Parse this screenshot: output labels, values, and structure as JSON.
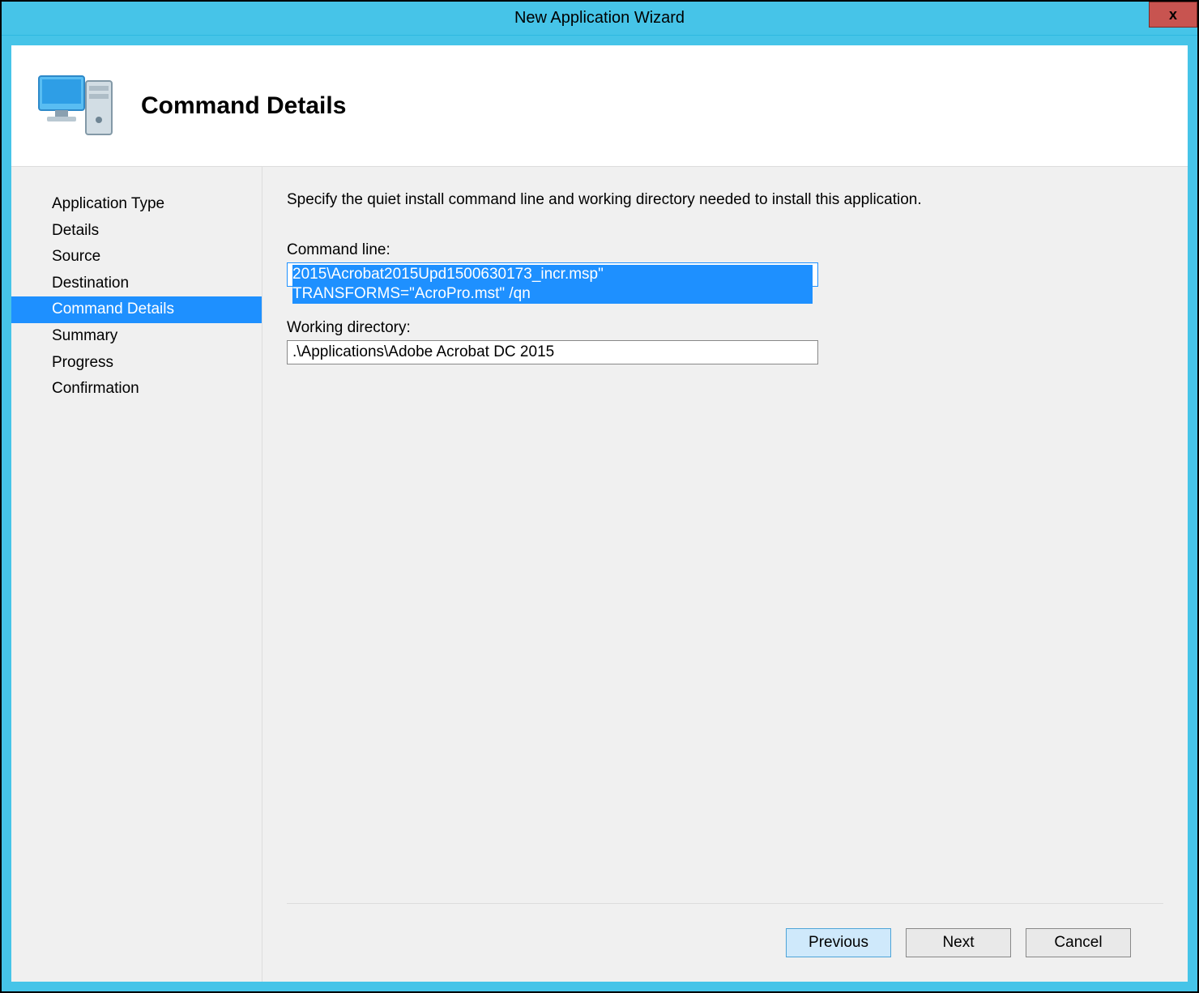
{
  "window": {
    "title": "New Application Wizard"
  },
  "banner": {
    "title": "Command Details"
  },
  "sidebar": {
    "items": [
      {
        "label": "Application Type",
        "selected": false
      },
      {
        "label": "Details",
        "selected": false
      },
      {
        "label": "Source",
        "selected": false
      },
      {
        "label": "Destination",
        "selected": false
      },
      {
        "label": "Command Details",
        "selected": true
      },
      {
        "label": "Summary",
        "selected": false
      },
      {
        "label": "Progress",
        "selected": false
      },
      {
        "label": "Confirmation",
        "selected": false
      }
    ]
  },
  "main": {
    "instruction": "Specify the quiet install command line and working directory needed to install this application.",
    "fields": {
      "command_line": {
        "label": "Command line:",
        "value": "2015\\Acrobat2015Upd1500630173_incr.msp\" TRANSFORMS=\"AcroPro.mst\"  /qn"
      },
      "working_dir": {
        "label": "Working directory:",
        "value": ".\\Applications\\Adobe Acrobat DC 2015"
      }
    }
  },
  "buttons": {
    "previous": "Previous",
    "next": "Next",
    "cancel": "Cancel"
  }
}
